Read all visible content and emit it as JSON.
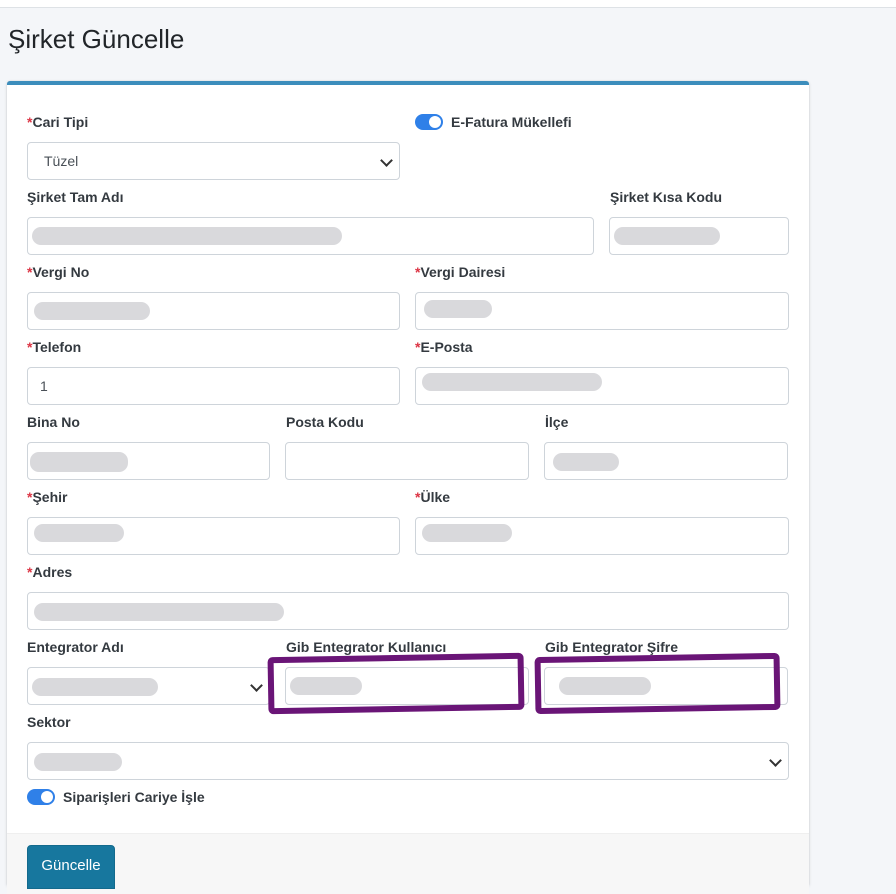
{
  "page": {
    "title": "Şirket Güncelle"
  },
  "form": {
    "cari_tipi": {
      "label": "Cari Tipi",
      "value": "Tüzel"
    },
    "efatura": {
      "label": "E-Fatura Mükellefi",
      "checked": true
    },
    "sirket_tam_adi": {
      "label": "Şirket Tam Adı"
    },
    "sirket_kisa_kodu": {
      "label": "Şirket Kısa Kodu"
    },
    "vergi_no": {
      "label": "Vergi No"
    },
    "vergi_dairesi": {
      "label": "Vergi Dairesi"
    },
    "telefon": {
      "label": "Telefon",
      "value": "1"
    },
    "eposta": {
      "label": "E-Posta"
    },
    "bina_no": {
      "label": "Bina No"
    },
    "posta_kodu": {
      "label": "Posta Kodu"
    },
    "ilce": {
      "label": "İlçe"
    },
    "sehir": {
      "label": "Şehir"
    },
    "ulke": {
      "label": "Ülke"
    },
    "adres": {
      "label": "Adres"
    },
    "entegrator_adi": {
      "label": "Entegrator Adı"
    },
    "gib_kullanici": {
      "label": "Gib Entegrator Kullanıcı"
    },
    "gib_sifre": {
      "label": "Gib Entegrator Şifre"
    },
    "sektor": {
      "label": "Sektor"
    },
    "siparisler": {
      "label": "Siparişleri Cariye İşle",
      "checked": true
    },
    "required_mark": "*"
  },
  "actions": {
    "submit_label": "Güncelle"
  },
  "colors": {
    "accent": "#3c8dbc",
    "button": "#17779e",
    "switch": "#2f80e8",
    "required": "#dc3545",
    "annotation": "#6a1577"
  }
}
